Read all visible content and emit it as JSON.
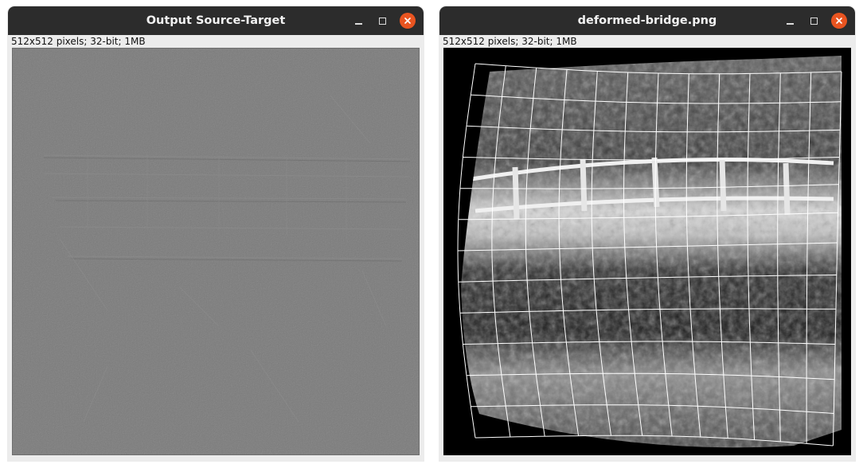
{
  "windows": [
    {
      "title": "Output Source-Target",
      "info": "512x512 pixels; 32-bit; 1MB"
    },
    {
      "title": "deformed-bridge.png",
      "info": "512x512 pixels; 32-bit; 1MB"
    }
  ],
  "controls": {
    "minimize_icon": "minimize-icon",
    "maximize_icon": "maximize-icon",
    "close_icon": "close-icon"
  },
  "colors": {
    "titlebar": "#2c2c2c",
    "close_button": "#e95420",
    "difference_gray": "#7b7b7b"
  }
}
